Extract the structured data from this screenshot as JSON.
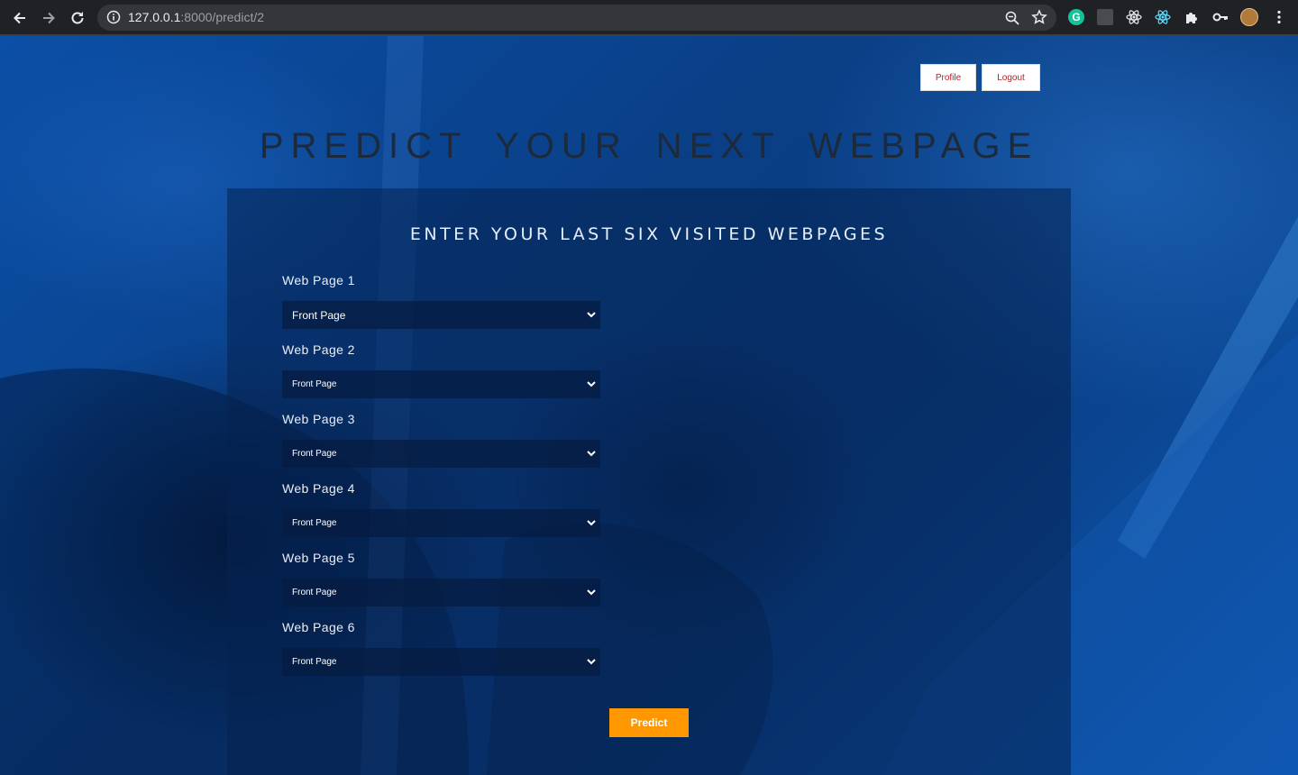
{
  "browser": {
    "url_host": "127.0.0.1",
    "url_path": ":8000/predict/2",
    "extension_g_label": "G"
  },
  "header": {
    "profile_label": "Profile",
    "logout_label": "Logout"
  },
  "main": {
    "title": "PREDICT YOUR NEXT WEBPAGE",
    "form_title": "ENTER YOUR LAST SIX VISITED WEBPAGES",
    "fields": [
      {
        "label": "Web Page 1",
        "value": "Front Page"
      },
      {
        "label": "Web Page 2",
        "value": "Front Page"
      },
      {
        "label": "Web Page 3",
        "value": "Front Page"
      },
      {
        "label": "Web Page 4",
        "value": "Front Page"
      },
      {
        "label": "Web Page 5",
        "value": "Front Page"
      },
      {
        "label": "Web Page 6",
        "value": "Front Page"
      }
    ],
    "predict_label": "Predict"
  },
  "colors": {
    "accent": "#ff9800",
    "button_text": "#b0232a",
    "background": "#0a4a9c"
  }
}
